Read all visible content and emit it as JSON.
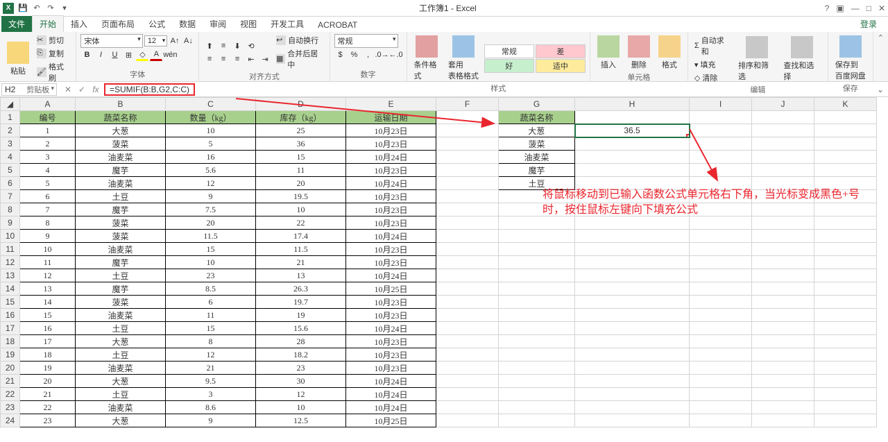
{
  "window": {
    "title": "工作簿1 - Excel",
    "signin": "登录"
  },
  "qat": {
    "save": "💾",
    "undo": "↶",
    "redo": "↷"
  },
  "tabs": [
    "文件",
    "开始",
    "插入",
    "页面布局",
    "公式",
    "数据",
    "审阅",
    "视图",
    "开发工具",
    "ACROBAT"
  ],
  "clipboard": {
    "paste": "粘贴",
    "cut": "剪切",
    "copy": "复制",
    "brush": "格式刷",
    "label": "剪贴板"
  },
  "font": {
    "name": "宋体",
    "size": "12",
    "label": "字体"
  },
  "align": {
    "wrap": "自动换行",
    "merge": "合并后居中",
    "label": "对齐方式"
  },
  "number": {
    "format": "常规",
    "label": "数字"
  },
  "styles": {
    "cond": "条件格式",
    "table": "套用\n表格格式",
    "normal": "常规",
    "bad": "差",
    "good": "好",
    "neutral": "适中",
    "label": "样式"
  },
  "cells": {
    "insert": "插入",
    "delete": "删除",
    "format": "格式",
    "label": "单元格"
  },
  "editing": {
    "sum": "自动求和",
    "fill": "填充",
    "clear": "清除",
    "sort": "排序和筛选",
    "find": "查找和选择",
    "label": "编辑"
  },
  "baidu": {
    "save": "保存到\n百度网盘",
    "label": "保存"
  },
  "namebox": "H2",
  "formula": "=SUMIF(B:B,G2,C:C)",
  "columns": [
    "A",
    "B",
    "C",
    "D",
    "E",
    "F",
    "G",
    "H",
    "I",
    "J",
    "K"
  ],
  "table1": {
    "headers": [
      "编号",
      "蔬菜名称",
      "数量（kg）",
      "库存（kg）",
      "运输日期"
    ],
    "rows": [
      [
        "1",
        "大葱",
        "10",
        "25",
        "10月23日"
      ],
      [
        "2",
        "菠菜",
        "5",
        "36",
        "10月23日"
      ],
      [
        "3",
        "油麦菜",
        "16",
        "15",
        "10月24日"
      ],
      [
        "4",
        "魔芋",
        "5.6",
        "11",
        "10月23日"
      ],
      [
        "5",
        "油麦菜",
        "12",
        "20",
        "10月24日"
      ],
      [
        "6",
        "土豆",
        "9",
        "19.5",
        "10月23日"
      ],
      [
        "7",
        "魔芋",
        "7.5",
        "10",
        "10月23日"
      ],
      [
        "8",
        "菠菜",
        "20",
        "22",
        "10月23日"
      ],
      [
        "9",
        "菠菜",
        "11.5",
        "17.4",
        "10月24日"
      ],
      [
        "10",
        "油麦菜",
        "15",
        "11.5",
        "10月23日"
      ],
      [
        "11",
        "魔芋",
        "10",
        "21",
        "10月23日"
      ],
      [
        "12",
        "土豆",
        "23",
        "13",
        "10月24日"
      ],
      [
        "13",
        "魔芋",
        "8.5",
        "26.3",
        "10月25日"
      ],
      [
        "14",
        "菠菜",
        "6",
        "19.7",
        "10月23日"
      ],
      [
        "15",
        "油麦菜",
        "11",
        "19",
        "10月23日"
      ],
      [
        "16",
        "土豆",
        "15",
        "15.6",
        "10月24日"
      ],
      [
        "17",
        "大葱",
        "8",
        "28",
        "10月23日"
      ],
      [
        "18",
        "土豆",
        "12",
        "18.2",
        "10月23日"
      ],
      [
        "19",
        "油麦菜",
        "21",
        "23",
        "10月23日"
      ],
      [
        "20",
        "大葱",
        "9.5",
        "30",
        "10月24日"
      ],
      [
        "21",
        "土豆",
        "3",
        "12",
        "10月24日"
      ],
      [
        "22",
        "油麦菜",
        "8.6",
        "10",
        "10月24日"
      ],
      [
        "23",
        "大葱",
        "9",
        "12.5",
        "10月25日"
      ]
    ]
  },
  "table2": {
    "header": "蔬菜名称",
    "rows": [
      "大葱",
      "菠菜",
      "油麦菜",
      "魔芋",
      "土豆"
    ]
  },
  "result": "36.5",
  "annotation": "将鼠标移动到已输入函数公式单元格右下角，当光标变成黑色+号时，按住鼠标左键向下填充公式"
}
